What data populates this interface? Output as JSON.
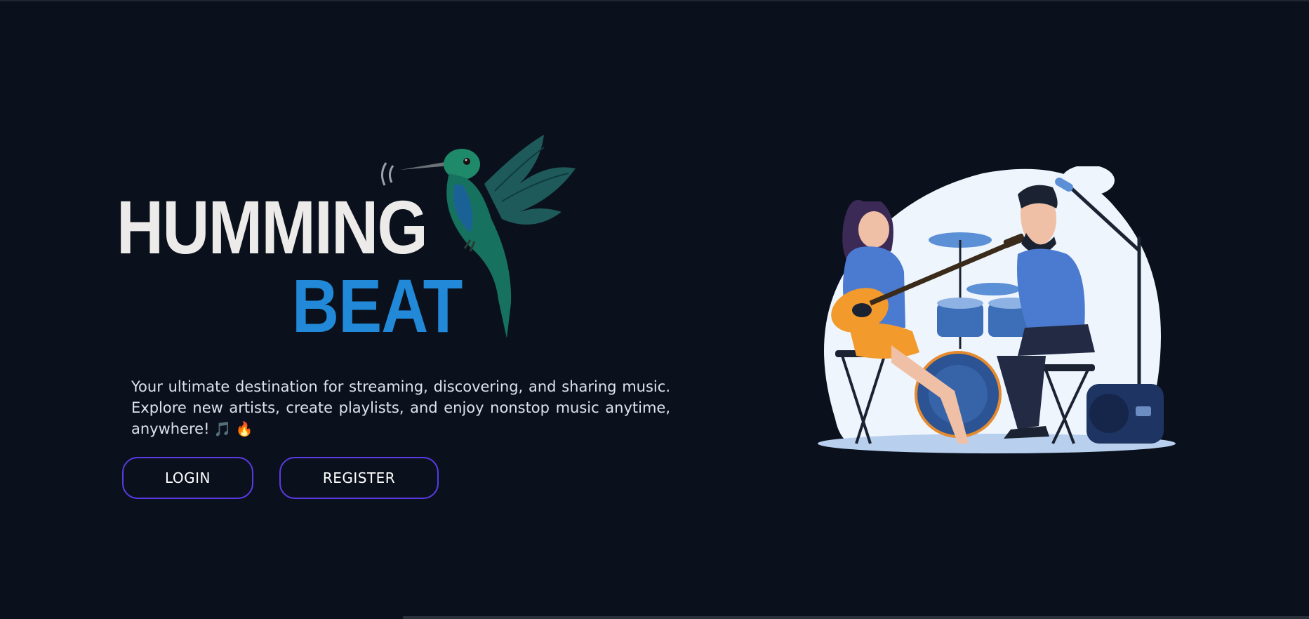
{
  "brand": {
    "line1": "HUMMING",
    "line2": "BEAT",
    "line1_color": "#ecebe9",
    "line2_color": "#2189d8",
    "mascot_icon": "hummingbird-icon"
  },
  "hero": {
    "tagline": "Your ultimate destination for streaming, discovering, and sharing music. Explore new artists, create playlists, and enjoy nonstop music anytime, anywhere!",
    "emoji_1": "🎵",
    "emoji_2": "🔥"
  },
  "actions": {
    "login_label": "LOGIN",
    "register_label": "REGISTER",
    "button_border_color": "#5b3ae6"
  },
  "theme": {
    "background": "#0a111c"
  },
  "illustration": {
    "icon": "band-playing-illustration"
  }
}
